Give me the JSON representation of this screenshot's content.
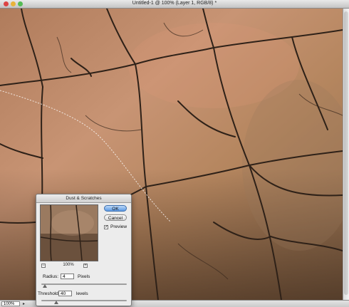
{
  "window": {
    "title": "Untitled-1 @ 100% (Layer 1, RGB/8) *"
  },
  "status": {
    "zoom": "100%"
  },
  "dialog": {
    "title": "Dust & Scratches",
    "ok_label": "OK",
    "cancel_label": "Cancel",
    "preview_label": "Preview",
    "preview_checked": true,
    "preview_zoom": "100%",
    "zoom_out": "−",
    "zoom_in": "+",
    "radius": {
      "label": "Radius:",
      "value": "4",
      "unit": "Pixels",
      "fraction": 0.02
    },
    "threshold": {
      "label": "Threshold:",
      "value": "40",
      "unit": "levels",
      "fraction": 0.16
    }
  },
  "colors": {
    "rock": "#a97a57",
    "crack": "#2e2118",
    "ok_button": "#5d9ae4"
  }
}
